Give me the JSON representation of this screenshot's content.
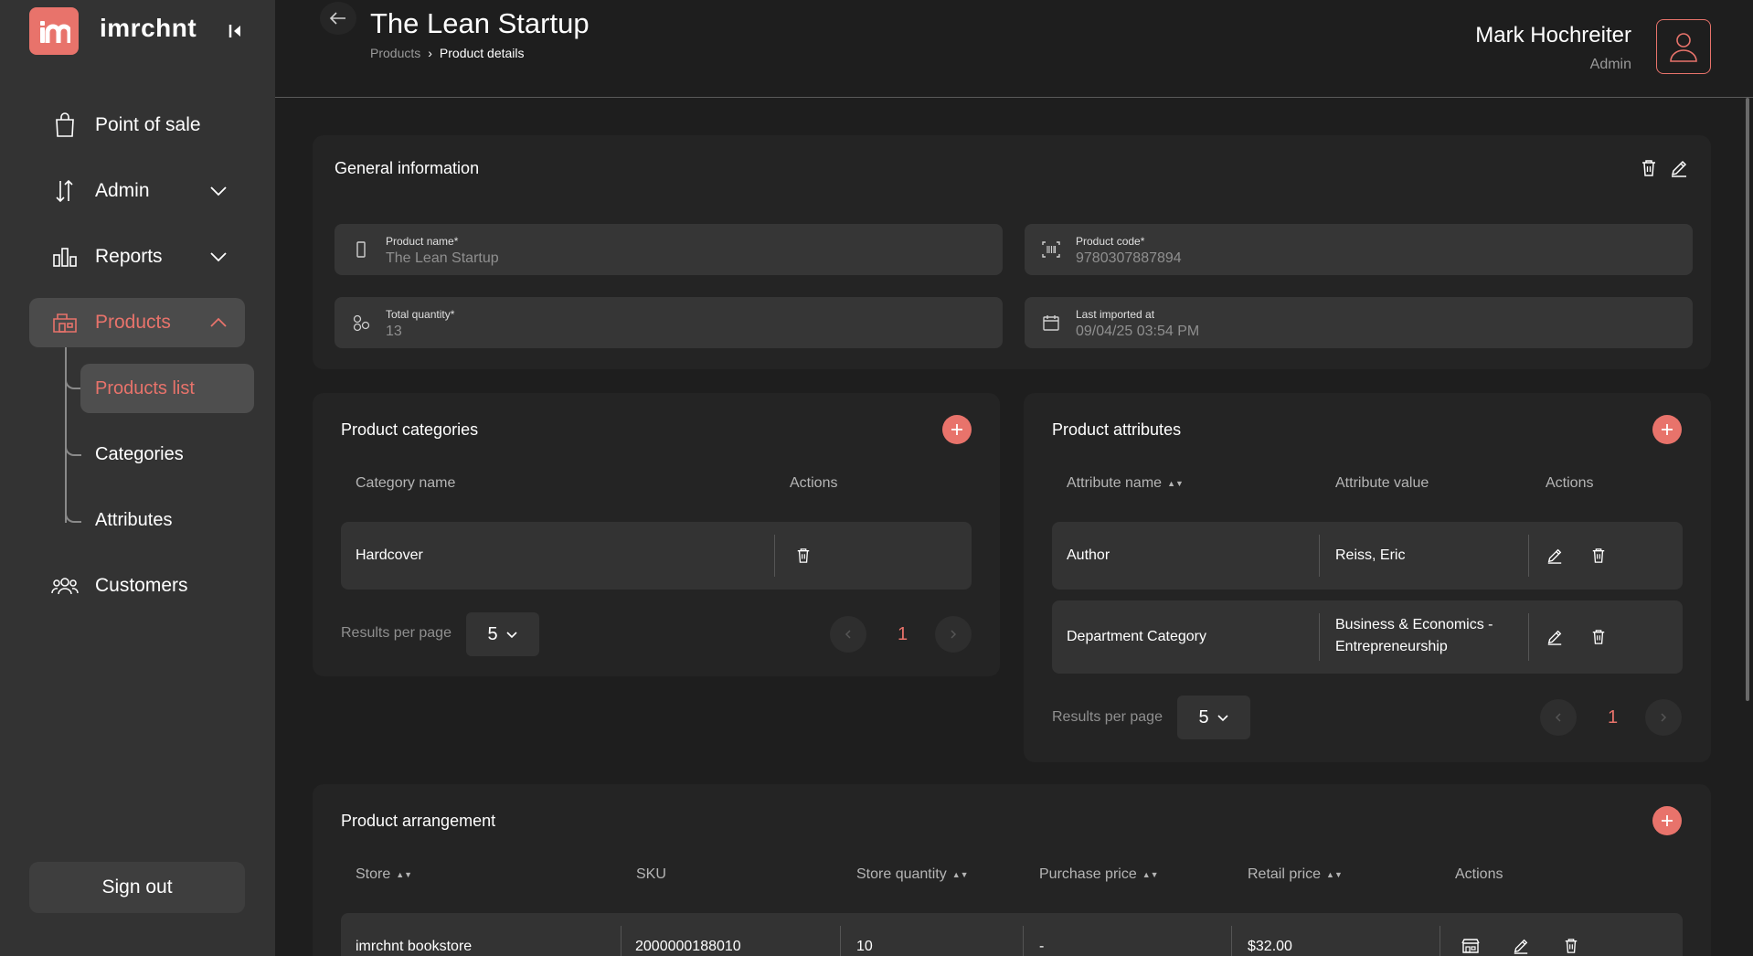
{
  "sidebar": {
    "logo_text": "imrchnt",
    "items": [
      {
        "label": "Point of sale"
      },
      {
        "label": "Admin"
      },
      {
        "label": "Reports"
      },
      {
        "label": "Products"
      },
      {
        "label": "Customers"
      }
    ],
    "subitems": [
      {
        "label": "Products list"
      },
      {
        "label": "Categories"
      },
      {
        "label": "Attributes"
      }
    ],
    "signout_label": "Sign out"
  },
  "header": {
    "title": "The Lean Startup",
    "breadcrumb": [
      "Products",
      "Product details"
    ],
    "user_name": "Mark Hochreiter",
    "user_role": "Admin"
  },
  "general": {
    "title": "General information",
    "fields": {
      "name": {
        "label": "Product name*",
        "value": "The Lean Startup"
      },
      "code": {
        "label": "Product code*",
        "value": "9780307887894"
      },
      "quantity": {
        "label": "Total quantity*",
        "value": "13"
      },
      "imported": {
        "label": "Last imported at",
        "value": "09/04/25 03:54 PM"
      }
    }
  },
  "categories": {
    "title": "Product categories",
    "headers": [
      "Category name",
      "Actions"
    ],
    "rows": [
      {
        "name": "Hardcover"
      }
    ],
    "rpp_label": "Results per page",
    "rpp_value": "5",
    "page": "1"
  },
  "attributes": {
    "title": "Product attributes",
    "headers": [
      "Attribute name",
      "Attribute value",
      "Actions"
    ],
    "rows": [
      {
        "name": "Author",
        "value": "Reiss, Eric"
      },
      {
        "name": "Department Category",
        "value_line1": "Business & Economics -",
        "value_line2": "Entrepreneurship"
      }
    ],
    "rpp_label": "Results per page",
    "rpp_value": "5",
    "page": "1"
  },
  "arrangement": {
    "title": "Product arrangement",
    "headers": [
      "Store",
      "SKU",
      "Store quantity",
      "Purchase price",
      "Retail price",
      "Actions"
    ],
    "rows": [
      {
        "store": "imrchnt bookstore",
        "sku": "2000000188010",
        "quantity": "10",
        "purchase": "-",
        "retail": "$32.00"
      }
    ]
  },
  "colors": {
    "accent": "#e8736b",
    "sidebar": "#333333",
    "background": "#1e1e1e",
    "card": "#242424"
  }
}
